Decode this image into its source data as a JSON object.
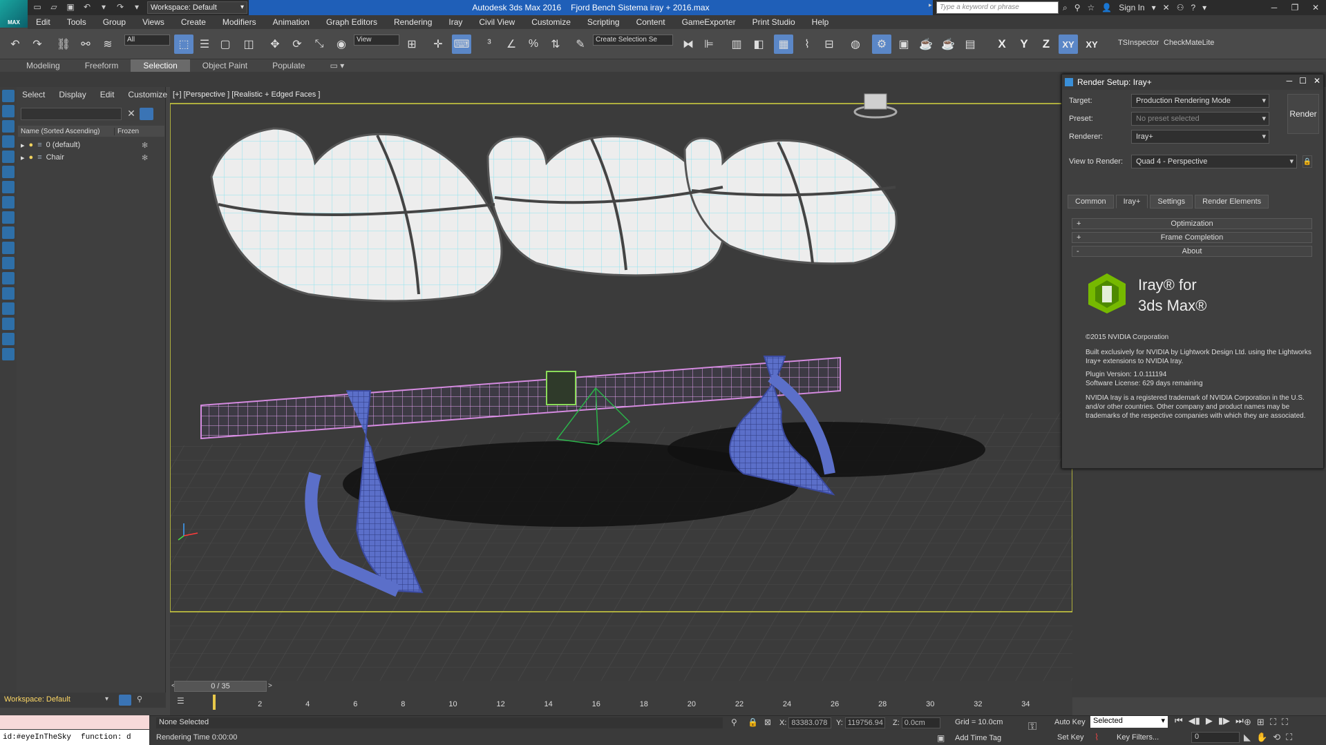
{
  "titlebar": {
    "workspace": "Workspace: Default",
    "app": "Autodesk 3ds Max 2016",
    "file": "Fjord Bench Sistema iray + 2016.max",
    "search_placeholder": "Type a keyword or phrase",
    "sign_in": "Sign In"
  },
  "logo_text": "MAX",
  "menu": [
    "Edit",
    "Tools",
    "Group",
    "Views",
    "Create",
    "Modifiers",
    "Animation",
    "Graph Editors",
    "Rendering",
    "Iray",
    "Civil View",
    "Customize",
    "Scripting",
    "Content",
    "GameExporter",
    "Print Studio",
    "Help"
  ],
  "toolbar": {
    "filter": "All",
    "ref_coord": "View",
    "selection_set": "Create Selection Se",
    "axis_x": "X",
    "axis_y": "Y",
    "axis_z": "Z",
    "axis_xy": "XY",
    "axis_xy2": "XY",
    "tsinspector": "TSInspector",
    "checkmate": "CheckMateLite"
  },
  "ribbon": {
    "tabs": [
      "Modeling",
      "Freeform",
      "Selection",
      "Object Paint",
      "Populate"
    ],
    "active": "Selection"
  },
  "explorer": {
    "menu": [
      "Select",
      "Display",
      "Edit",
      "Customize"
    ],
    "col_name": "Name (Sorted Ascending)",
    "col_frozen": "Frozen",
    "rows": [
      "0 (default)",
      "Chair"
    ],
    "workspace": "Workspace: Default"
  },
  "viewport": {
    "label": "[+] [Perspective ] [Realistic + Edged Faces ]"
  },
  "render_setup": {
    "title": "Render Setup: Iray+",
    "target_label": "Target:",
    "target": "Production Rendering Mode",
    "preset_label": "Preset:",
    "preset": "No preset selected",
    "renderer_label": "Renderer:",
    "renderer": "Iray+",
    "view_label": "View to Render:",
    "view": "Quad 4 - Perspective",
    "render_button": "Render",
    "tabs": [
      "Common",
      "Iray+",
      "Settings",
      "Render Elements"
    ],
    "active_tab": "Iray+",
    "rollouts": [
      {
        "sign": "+",
        "label": "Optimization"
      },
      {
        "sign": "+",
        "label": "Frame Completion"
      },
      {
        "sign": "-",
        "label": "About"
      }
    ],
    "about": {
      "title_line1": "Iray® for",
      "title_line2": "3ds Max®",
      "copyright": "©2015 NVIDIA Corporation",
      "built": "Built exclusively for NVIDIA by Lightwork Design Ltd. using the Lightworks Iray+ extensions to NVIDIA Iray.",
      "plugin_version": "Plugin Version: 1.0.111194",
      "license": "Software License: 629 days remaining",
      "trademark": "NVIDIA Iray is a registered trademark of NVIDIA Corporation in the U.S. and/or other countries. Other company and product names may be trademarks of the respective companies with which they are associated."
    }
  },
  "timeline": {
    "position": "0 / 35",
    "ticks": [
      "2",
      "4",
      "6",
      "8",
      "10",
      "12",
      "14",
      "16",
      "18",
      "20",
      "22",
      "24",
      "26",
      "28",
      "30",
      "32",
      "34"
    ]
  },
  "status": {
    "maxscript": "id:#eyeInTheSky",
    "maxscript2": "function: d",
    "selection": "None Selected",
    "render_time": "Rendering Time  0:00:00",
    "x_label": "X:",
    "x": "83383.078",
    "y_label": "Y:",
    "y": "119756.94",
    "z_label": "Z:",
    "z": "0.0cm",
    "grid": "Grid = 10.0cm",
    "add_time_tag": "Add Time Tag",
    "auto_key": "Auto Key",
    "set_key": "Set Key",
    "selected": "Selected",
    "key_filters": "Key Filters...",
    "frame": "0"
  },
  "colors": {
    "title_blue": "#1f5fb8",
    "accent": "#5b87c7",
    "nvidia_green": "#76b900",
    "wire_cyan": "#6fd6e6",
    "beam_pink": "#d58be0",
    "leg_blue": "#4a5fb8"
  }
}
